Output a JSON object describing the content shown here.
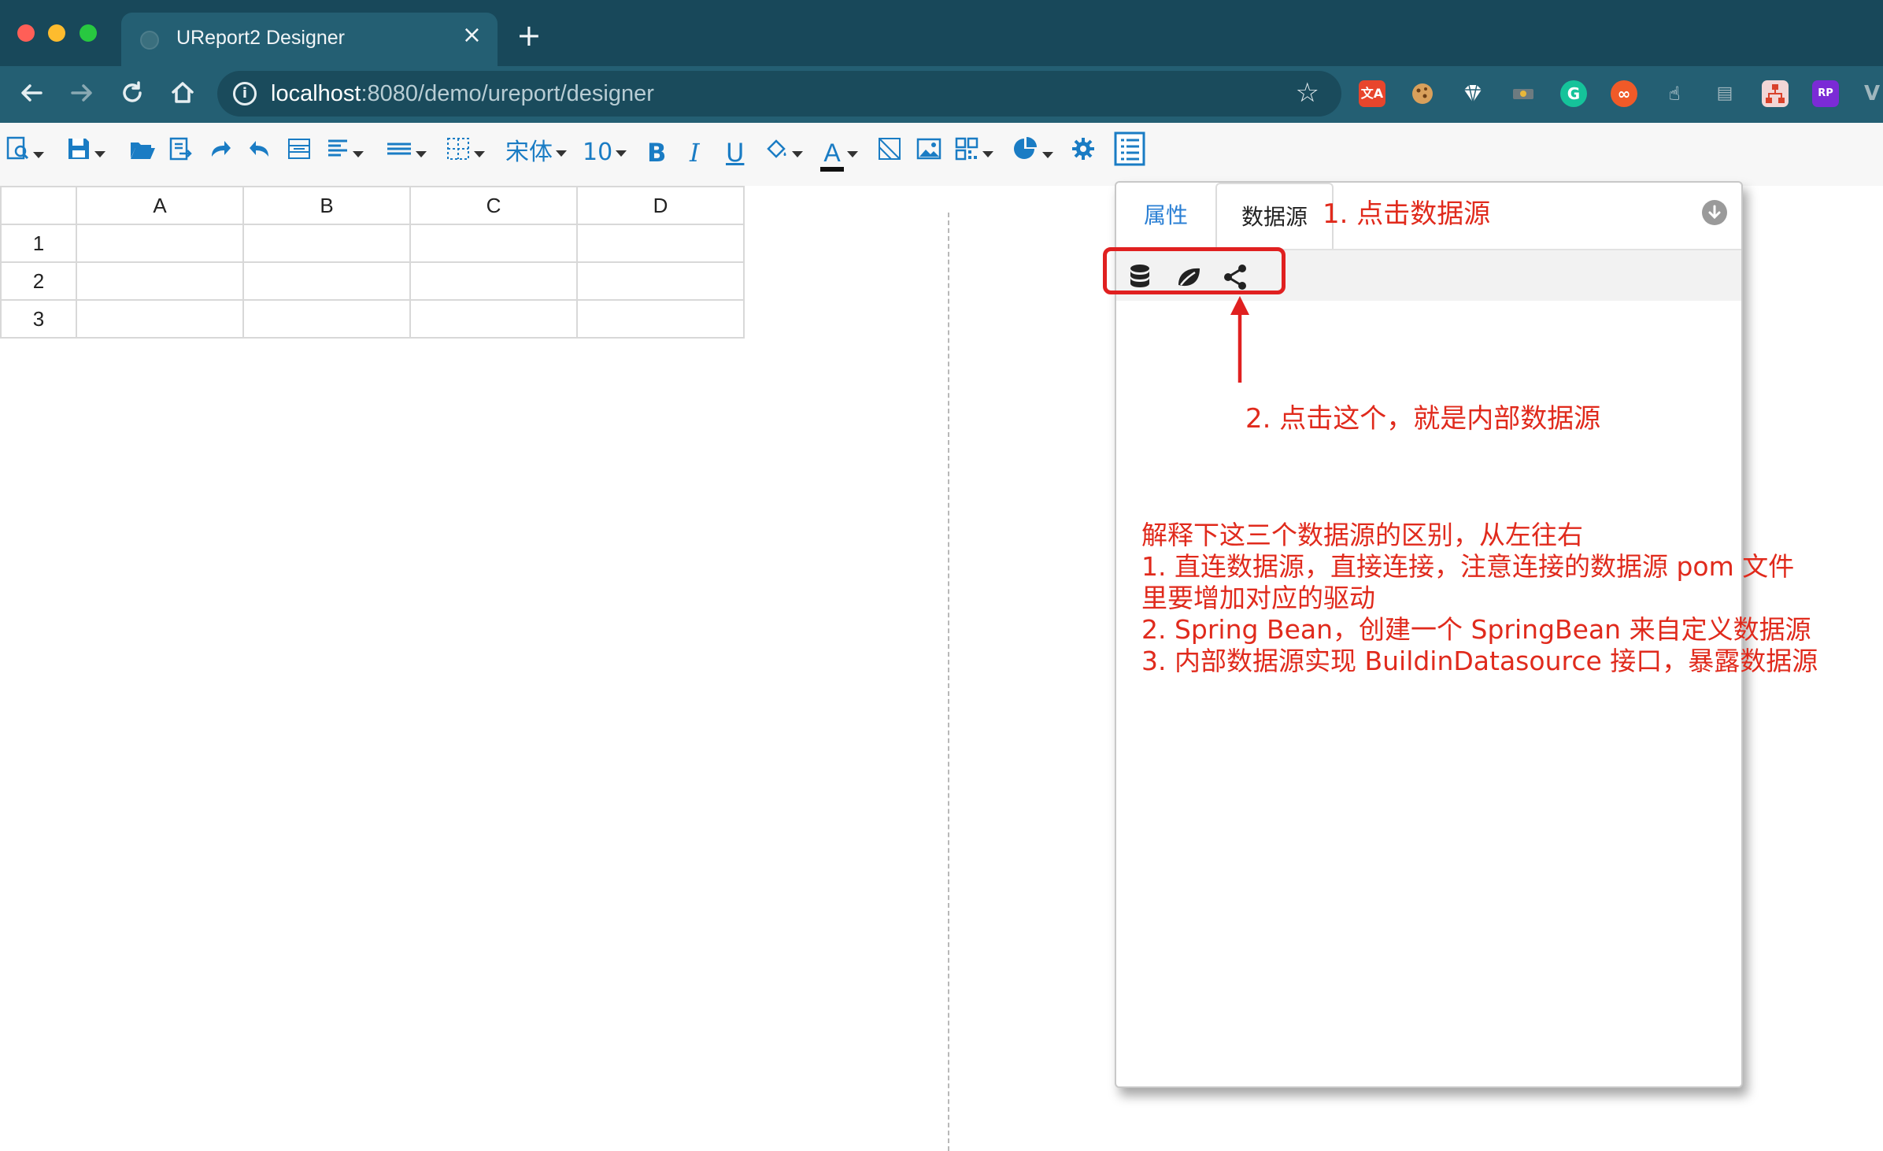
{
  "browser": {
    "tab_title": "UReport2 Designer",
    "tab_close": "×",
    "new_tab": "+",
    "url_host": "localhost",
    "url_rest": ":8080/demo/ureport/designer",
    "info": "i",
    "star": "☆",
    "extensions": [
      "translate-extension-icon",
      "cookie-extension-icon",
      "diamond-extension-icon",
      "screen-recorder-extension-icon",
      "grammarly-extension-icon",
      "infinity-extension-icon",
      "pointer-extension-icon",
      "reader-extension-icon",
      "hierarchy-extension-icon",
      "rp-extension-icon",
      "v-extension-icon"
    ]
  },
  "toolbar": {
    "font_name": "宋体",
    "font_size": "10",
    "bold": "B",
    "italic": "I",
    "underline": "U",
    "font_color_glyph": "A"
  },
  "grid": {
    "columns": [
      "A",
      "B",
      "C",
      "D"
    ],
    "rows": [
      "1",
      "2",
      "3"
    ]
  },
  "panel": {
    "tabs": [
      "属性",
      "数据源"
    ],
    "active_tab": "数据源"
  },
  "annotations": {
    "step1": "1. 点击数据源",
    "step2": "2. 点击这个，就是内部数据源",
    "explain": [
      "解释下这三个数据源的区别，从左往右",
      "1. 直连数据源，直接连接，注意连接的数据源 pom 文件",
      "里要增加对应的驱动",
      "2. Spring Bean，创建一个 SpringBean 来自定义数据源",
      "3. 内部数据源实现 BuildinDatasource 接口，暴露数据源"
    ]
  },
  "colors": {
    "tabbar": "#18485a",
    "navbar": "#245f73",
    "accent": "#1a7cc4",
    "annotation": "#e02a1c"
  }
}
